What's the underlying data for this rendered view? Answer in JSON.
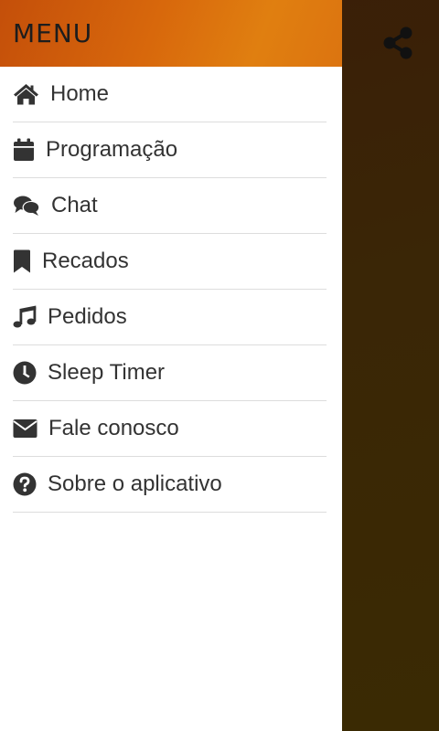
{
  "drawer": {
    "title": "MENU",
    "items": [
      {
        "label": "Home",
        "icon": "home-icon"
      },
      {
        "label": "Programação",
        "icon": "calendar-icon"
      },
      {
        "label": "Chat",
        "icon": "chat-icon"
      },
      {
        "label": "Recados",
        "icon": "bookmark-icon"
      },
      {
        "label": "Pedidos",
        "icon": "music-note-icon"
      },
      {
        "label": "Sleep Timer",
        "icon": "clock-icon"
      },
      {
        "label": "Fale conosco",
        "icon": "envelope-icon"
      },
      {
        "label": "Sobre o aplicativo",
        "icon": "question-circle-icon"
      }
    ]
  },
  "topbar": {
    "share_icon": "share-icon"
  },
  "colors": {
    "header_start": "#c44f0a",
    "header_end": "#e07f10",
    "background": "#3a2606",
    "text": "#333333"
  }
}
